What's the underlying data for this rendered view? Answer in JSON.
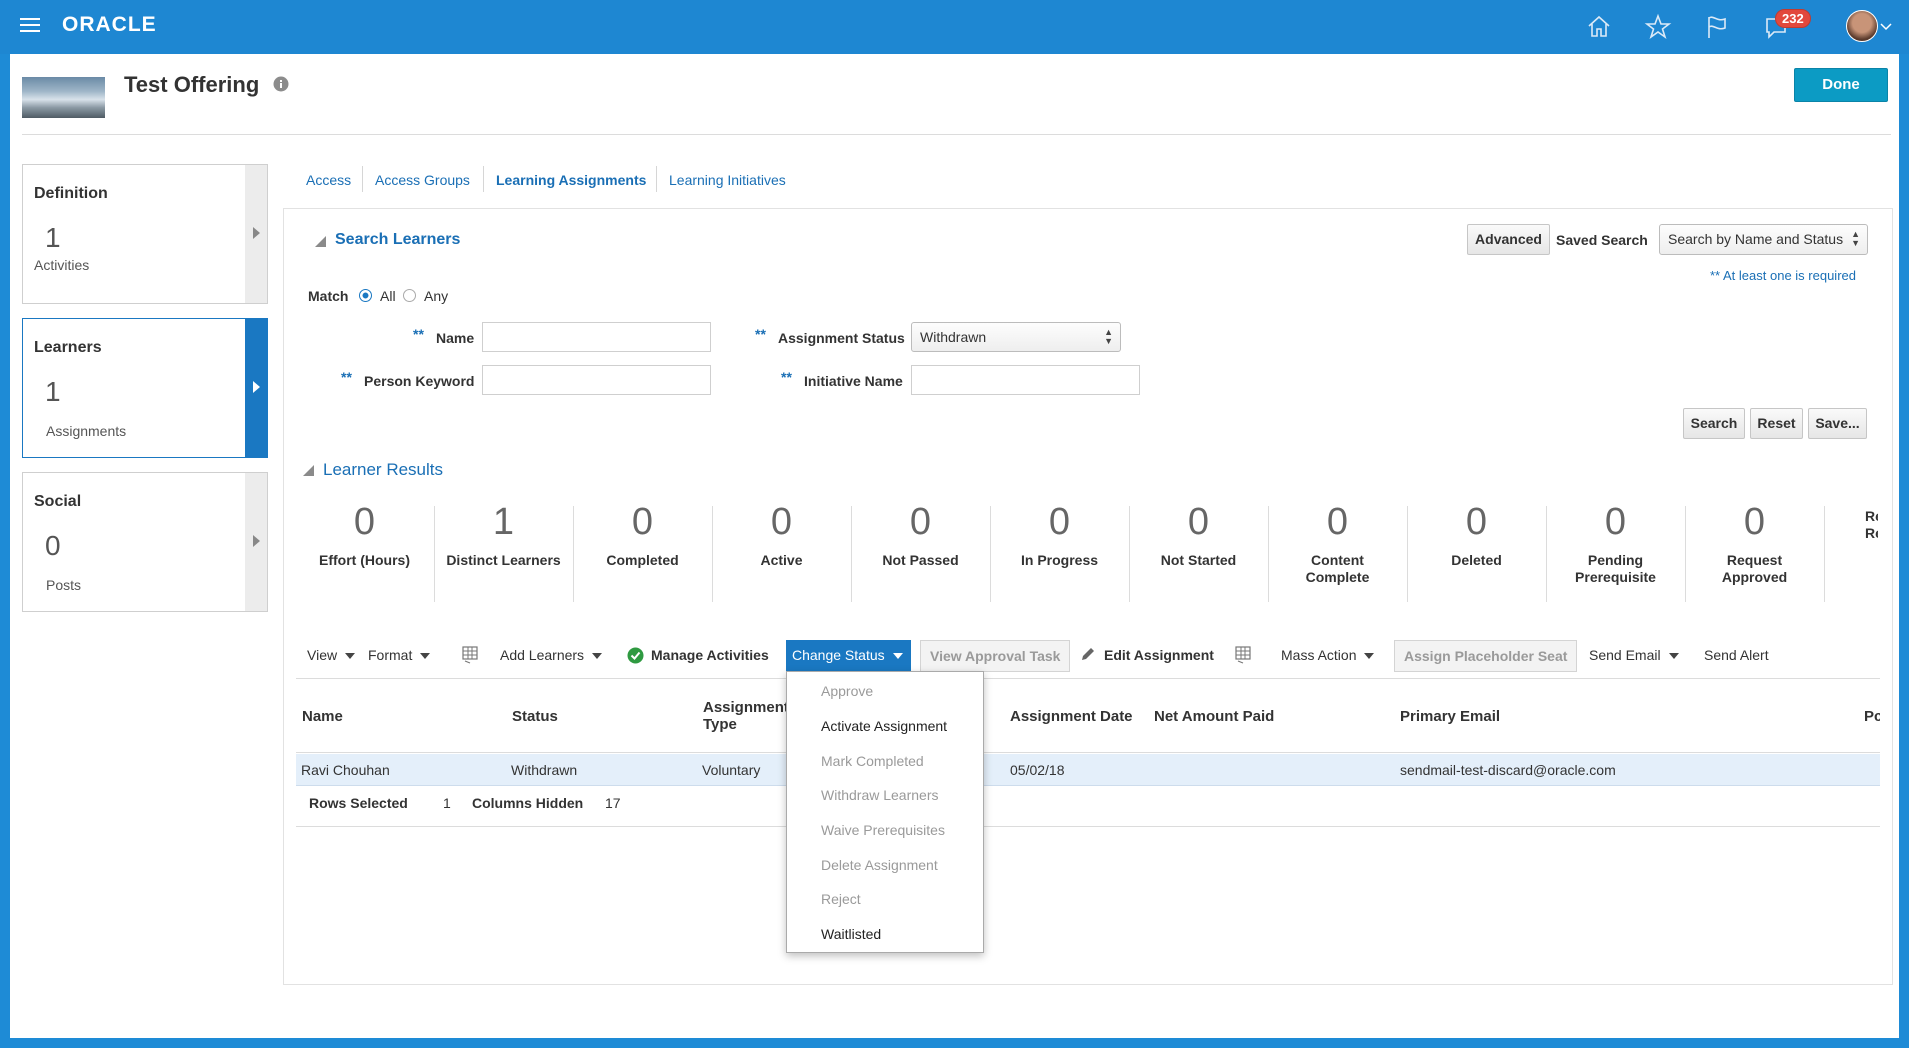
{
  "app": {
    "brand": "ORACLE",
    "notification_count": "232"
  },
  "header": {
    "title": "Test Offering",
    "done_label": "Done"
  },
  "tiles": [
    {
      "heading": "Definition",
      "number": "1",
      "sub": "Activities"
    },
    {
      "heading": "Learners",
      "number": "1",
      "sub": "Assignments"
    },
    {
      "heading": "Social",
      "number": "0",
      "sub": "Posts"
    }
  ],
  "tabs": [
    "Access",
    "Access Groups",
    "Learning Assignments",
    "Learning Initiatives"
  ],
  "search": {
    "title": "Search Learners",
    "advanced": "Advanced",
    "saved_search_label": "Saved Search",
    "saved_search_value": "Search by Name and Status",
    "required_note": "** At least one is required",
    "match_label": "Match",
    "match_all": "All",
    "match_any": "Any",
    "star": "**",
    "name_label": "Name",
    "keyword_label": "Person Keyword",
    "status_label": "Assignment Status",
    "status_value": "Withdrawn",
    "initiative_label": "Initiative Name",
    "search_btn": "Search",
    "reset_btn": "Reset",
    "save_btn": "Save..."
  },
  "results": {
    "title": "Learner Results",
    "metrics": [
      {
        "value": "0",
        "label": "Effort (Hours)"
      },
      {
        "value": "1",
        "label": "Distinct Learners"
      },
      {
        "value": "0",
        "label": "Completed"
      },
      {
        "value": "0",
        "label": "Active"
      },
      {
        "value": "0",
        "label": "Not Passed"
      },
      {
        "value": "0",
        "label": "In Progress"
      },
      {
        "value": "0",
        "label": "Not Started"
      },
      {
        "value": "0",
        "label": "Content Complete"
      },
      {
        "value": "0",
        "label": "Deleted"
      },
      {
        "value": "0",
        "label": "Pending Prerequisite"
      },
      {
        "value": "0",
        "label": "Request Approved"
      },
      {
        "value": "",
        "label": "Re Re"
      }
    ]
  },
  "toolbar": {
    "view": "View",
    "format": "Format",
    "add_learners": "Add Learners",
    "manage_activities": "Manage Activities",
    "change_status": "Change Status",
    "view_approval_task": "View Approval Task",
    "edit_assignment": "Edit Assignment",
    "mass_action": "Mass Action",
    "assign_placeholder_seat": "Assign Placeholder Seat",
    "send_email": "Send Email",
    "send_alert": "Send Alert"
  },
  "table": {
    "headers": {
      "name": "Name",
      "status": "Status",
      "assignment_type": "Assignment Type",
      "assignment_date": "Assignment Date",
      "net_amount_paid": "Net Amount Paid",
      "primary_email": "Primary Email",
      "cut": "Pc"
    },
    "row": {
      "name": "Ravi Chouhan",
      "status": "Withdrawn",
      "assignment_type": "Voluntary",
      "assignment_date": "05/02/18",
      "primary_email": "sendmail-test-discard@oracle.com"
    },
    "footer": {
      "rows_selected_label": "Rows Selected",
      "rows_selected": "1",
      "columns_hidden_label": "Columns Hidden",
      "columns_hidden": "17"
    }
  },
  "menu": [
    {
      "label": "Approve",
      "enabled": false
    },
    {
      "label": "Activate Assignment",
      "enabled": true
    },
    {
      "label": "Mark Completed",
      "enabled": false
    },
    {
      "label": "Withdraw Learners",
      "enabled": false
    },
    {
      "label": "Waive Prerequisites",
      "enabled": false
    },
    {
      "label": "Delete Assignment",
      "enabled": false
    },
    {
      "label": "Reject",
      "enabled": false
    },
    {
      "label": "Waitlisted",
      "enabled": true
    }
  ],
  "colors": {
    "brand_blue": "#1e87d2",
    "link_blue": "#1a6fb5",
    "done_teal": "#0c9bc4",
    "selected_row": "#e4effa",
    "badge_red": "#e2483c"
  }
}
